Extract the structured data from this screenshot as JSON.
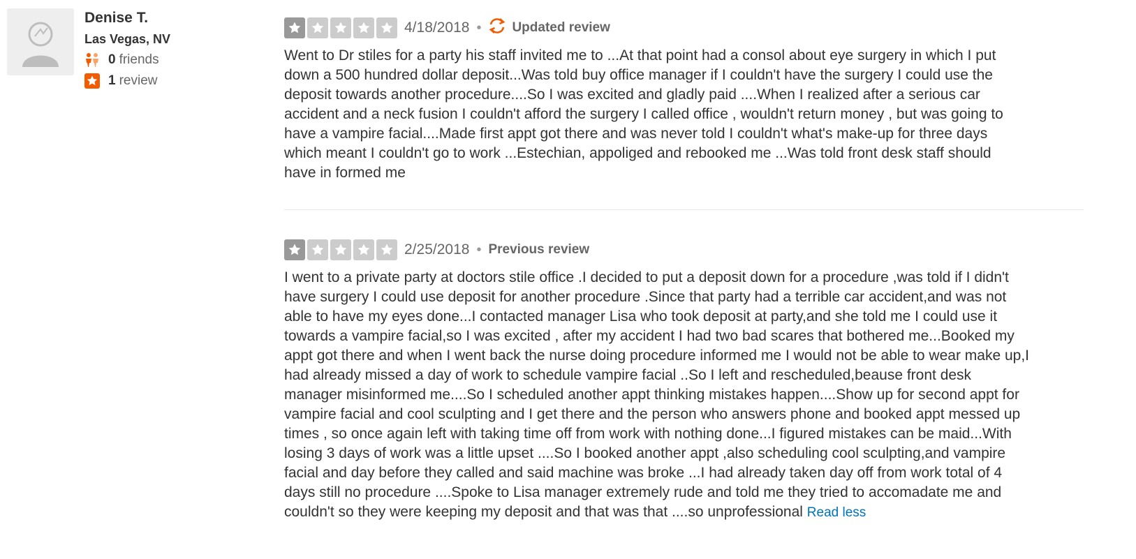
{
  "user": {
    "name": "Denise T.",
    "location": "Las Vegas, NV",
    "friends_count": "0",
    "friends_label": "friends",
    "reviews_count": "1",
    "reviews_label": "review"
  },
  "colors": {
    "accent": "#f15c00",
    "link": "#0073bb",
    "star_active": "#999999",
    "star_inactive": "#cccccc"
  },
  "reviews": [
    {
      "rating": 1,
      "date": "4/18/2018",
      "tag": "Updated review",
      "tag_icon": "refresh-icon",
      "text": "Went to Dr stiles for a party his staff invited me to ...At that point had a consol about eye surgery in which I put\ndown a 500 hundred dollar deposit...Was told buy office manager if I couldn't have the surgery I could use the\ndeposit towards another procedure....So I was excited and gladly paid ....When I realized after a serious car\naccident and a neck fusion I couldn't afford the surgery I called office , wouldn't return money , but was going to\nhave a vampire facial....Made first appt got there and was never told I couldn't what's make-up for three days\nwhich meant I couldn't go to work ...Estechian, appoliged and rebooked me ...Was told front desk staff should\nhave in formed me"
    },
    {
      "rating": 1,
      "date": "2/25/2018",
      "tag": "Previous review",
      "text": "I went to a private party at doctors stile office .I decided to put a deposit down for a procedure ,was told if I didn't\nhave surgery I could use deposit for another procedure .Since that party had a terrible car accident,and was not\nable to have my eyes done...I contacted manager Lisa who took deposit at party,and she told me I could use it\ntowards a vampire facial,so I was excited , after my accident I had two bad scares that bothered me...Booked my\nappt got there and when I went back the nurse doing procedure informed me I would not be able to wear make up,I\nhad already missed a day of work to schedule vampire facial ..So I left and rescheduled,beause front desk\nmanager misinformed me....So I scheduled another appt thinking mistakes happen....Show up for second appt for\nvampire facial and cool sculpting and I get there and the person who answers phone and booked appt messed up\ntimes , so once again left with taking time off from work with nothing done...I figured mistakes can be maid...With\nlosing 3 days of work was a little upset ....So I booked another appt ,also scheduling cool sculpting,and vampire\nfacial and day before they called and said machine was broke ...I had already taken day off from work total of 4\ndays still no procedure ....Spoke to Lisa manager extremely rude and told me they tried to accomadate me and\ncouldn't so they were keeping my deposit and that was that ....so unprofessional ",
      "read_less": "Read less"
    }
  ]
}
